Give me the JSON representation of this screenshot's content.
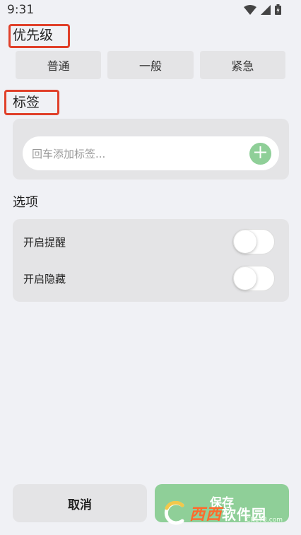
{
  "status_bar": {
    "time": "9:31"
  },
  "priority": {
    "label": "优先级",
    "options": [
      "普通",
      "一般",
      "紧急"
    ]
  },
  "tags": {
    "label": "标签",
    "input_placeholder": "回车添加标签..."
  },
  "options": {
    "label": "选项",
    "items": [
      {
        "label": "开启提醒",
        "enabled": false
      },
      {
        "label": "开启隐藏",
        "enabled": false
      }
    ]
  },
  "actions": {
    "cancel_label": "取消",
    "save_label": "保存"
  },
  "watermark": {
    "brand_a": "西西",
    "brand_b": "软件园",
    "domain": "CR173.com"
  },
  "colors": {
    "accent_green": "#8fcf98",
    "highlight_red": "#e0402a",
    "background": "#f0f1f5"
  }
}
